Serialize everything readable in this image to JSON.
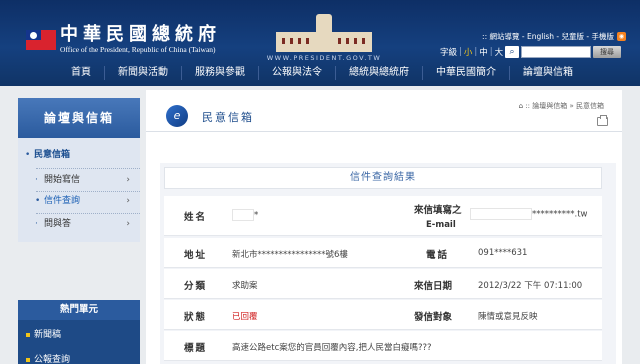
{
  "header": {
    "title_zh": "中華民國總統府",
    "title_en": "Office of the President, Republic of China (Taiwan)",
    "site_url": "WWW.PRESIDENT.GOV.TW",
    "top_links": ":: 網站導覽 - English - 兒童版 - 手機版",
    "font_size_label": "字級",
    "font_sizes": [
      "小",
      "中",
      "大"
    ],
    "search_placeholder": "",
    "search_button": "搜尋",
    "nav": [
      "首頁",
      "新聞與活動",
      "服務與參觀",
      "公報與法令",
      "總統與總統府",
      "中華民國簡介",
      "論壇與信箱"
    ]
  },
  "sidebar": {
    "title": "論壇與信箱",
    "items": [
      {
        "label": "民意信箱",
        "type": "active"
      },
      {
        "label": "開始寫信",
        "type": "sub"
      },
      {
        "label": "信件查詢",
        "type": "sub-current"
      },
      {
        "label": "問與答",
        "type": "sub"
      }
    ],
    "hot_title": "熱門單元",
    "hot_items": [
      "新聞稿",
      "公報查詢"
    ]
  },
  "main": {
    "title": "民意信箱",
    "breadcrumb": ":: 論壇與信箱 » 民意信箱",
    "result_title": "信件查詢結果",
    "fields": {
      "name_label": "姓名",
      "name_value": "*",
      "email_label": "來信填寫之",
      "email_label2": "E-mail",
      "email_value": "**********.tw",
      "address_label": "地址",
      "address_value": "新北市****************號6樓",
      "phone_label": "電話",
      "phone_value": "091****631",
      "category_label": "分類",
      "category_value": "求助案",
      "date_label": "來信日期",
      "date_value": "2012/3/22 下午 07:11:00",
      "status_label": "狀態",
      "status_value": "已回覆",
      "target_label": "發信對象",
      "target_value": "陳情或意見反映",
      "subject_label": "標題",
      "subject_value": "高速公路etc案您的官員回覆內容,把人民當白癡嗎???"
    }
  },
  "colors": {
    "header_bg": "#15407f",
    "accent_blue": "#1e4d8c",
    "status_red": "#d02020"
  }
}
